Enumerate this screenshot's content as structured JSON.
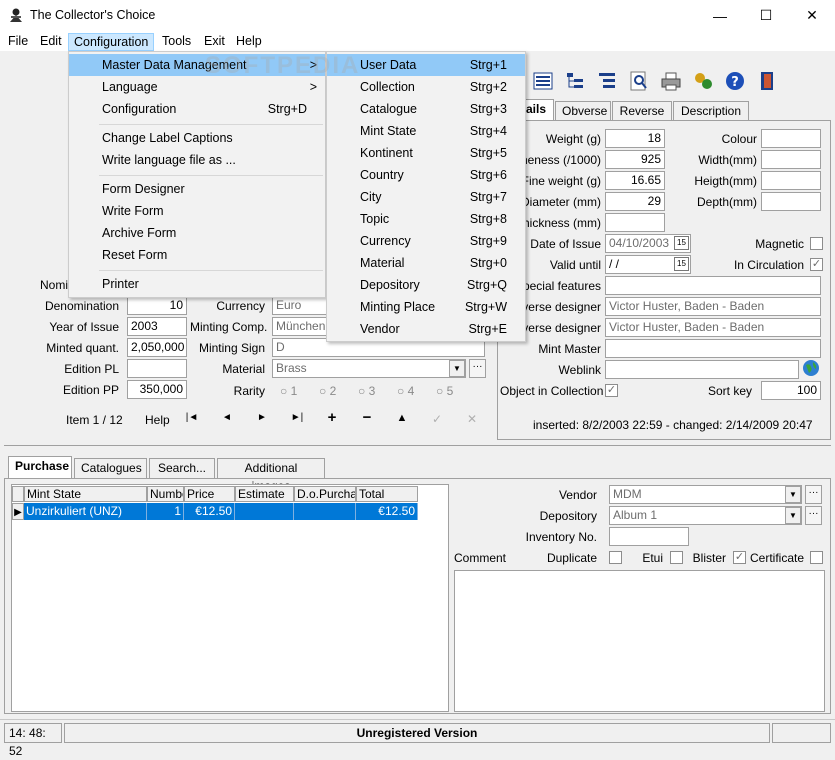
{
  "window": {
    "title": "The Collector's Choice",
    "minimize": "—",
    "maximize": "☐",
    "close": "✕"
  },
  "menubar": [
    "File",
    "Edit",
    "Configuration",
    "Tools",
    "Exit",
    "Help"
  ],
  "config_menu": {
    "items": [
      {
        "label": "Master Data Management",
        "arrow": ">"
      },
      {
        "label": "Language",
        "arrow": ">"
      },
      {
        "label": "Configuration",
        "shortcut": "Strg+D"
      },
      {
        "label": "Change Label Captions"
      },
      {
        "label": "Write language file as ..."
      },
      {
        "label": "Form Designer"
      },
      {
        "label": "Write Form"
      },
      {
        "label": "Archive Form"
      },
      {
        "label": "Reset Form"
      },
      {
        "label": "Printer"
      }
    ]
  },
  "master_submenu": {
    "items": [
      {
        "label": "User Data",
        "shortcut": "Strg+1"
      },
      {
        "label": "Collection",
        "shortcut": "Strg+2"
      },
      {
        "label": "Catalogue",
        "shortcut": "Strg+3"
      },
      {
        "label": "Mint State",
        "shortcut": "Strg+4"
      },
      {
        "label": "Kontinent",
        "shortcut": "Strg+5"
      },
      {
        "label": "Country",
        "shortcut": "Strg+6"
      },
      {
        "label": "City",
        "shortcut": "Strg+7"
      },
      {
        "label": "Topic",
        "shortcut": "Strg+8"
      },
      {
        "label": "Currency",
        "shortcut": "Strg+9"
      },
      {
        "label": "Material",
        "shortcut": "Strg+0"
      },
      {
        "label": "Depository",
        "shortcut": "Strg+Q"
      },
      {
        "label": "Minting Place",
        "shortcut": "Strg+W"
      },
      {
        "label": "Vendor",
        "shortcut": "Strg+E"
      }
    ]
  },
  "watermark": "SOFTPEDIA",
  "detail_tabs": [
    "ails",
    "Obverse",
    "Reverse",
    "Description"
  ],
  "details": {
    "weight_label": "Weight (g)",
    "weight": "18",
    "fineness_label": "neness (/1000)",
    "fineness": "925",
    "fine_weight_label": "Fine weight (g)",
    "fine_weight": "16.65",
    "diameter_label": "Diameter (mm)",
    "diameter": "29",
    "thickness_label": "Thickness (mm)",
    "thickness": "",
    "date_issue_label": "Date of Issue",
    "date_issue": "04/10/2003",
    "valid_until_label": "Valid until",
    "valid_until": " /  /",
    "calendar_icon_text": "15",
    "colour_label": "Colour",
    "width_label": "Width(mm)",
    "height_label": "Heigth(mm)",
    "depth_label": "Depth(mm)",
    "magnetic_label": "Magnetic",
    "in_circulation_label": "In Circulation",
    "special_features_label": "Special features",
    "obverse_designer_label": "verse designer",
    "obverse_designer": "Victor Huster, Baden - Baden",
    "reverse_designer_label": "everse designer",
    "reverse_designer": "Victor Huster, Baden - Baden",
    "mint_master_label": "Mint Master",
    "weblink_label": "Weblink",
    "object_in_collection_label": "Object in Collection",
    "sort_key_label": "Sort key",
    "sort_key": "100",
    "inserted_changed": "inserted: 8/2/2003 22:59 - changed: 2/14/2009 20:47"
  },
  "left_form": {
    "nomi_label": "Nomi",
    "denomination_label": "Denomination",
    "denomination": "10",
    "year_label": "Year of Issue",
    "year": "2003",
    "minted_label": "Minted quant.",
    "minted": "2,050,000",
    "edition_pl_label": "Edition PL",
    "edition_pl": "",
    "edition_pp_label": "Edition PP",
    "edition_pp": "350,000",
    "currency_label": "Currency",
    "currency": "Euro",
    "minting_comp_label": "Minting Comp.",
    "minting_comp": "München",
    "minting_sign_label": "Minting Sign",
    "minting_sign": "D",
    "material_label": "Material",
    "material": "Brass",
    "rarity_label": "Rarity",
    "rarity_options": [
      "1",
      "2",
      "3",
      "4",
      "5"
    ]
  },
  "nav": {
    "item_counter": "Item 1 / 12",
    "help": "Help",
    "first": "|◄",
    "prev": "◄",
    "next": "►",
    "last": "►|",
    "add": "+",
    "remove": "−",
    "up": "▲",
    "check": "✓",
    "cancel": "✕"
  },
  "bottom_tabs": [
    "Purchase",
    "Catalogues",
    "Search...",
    "Additional images"
  ],
  "grid": {
    "columns": [
      "Mint State",
      "Numbe",
      "Price",
      "Estimate",
      "D.o.Purchas",
      "Total"
    ],
    "rows": [
      {
        "marker": "▶",
        "mint_state": "Unzirkuliert (UNZ)",
        "number": "1",
        "price": "€12.50",
        "estimate": "",
        "purchase_date": "",
        "total": "€12.50"
      }
    ]
  },
  "purchase": {
    "vendor_label": "Vendor",
    "vendor": "MDM",
    "depository_label": "Depository",
    "depository": "Album 1",
    "inventory_label": "Inventory No.",
    "comment_label": "Comment",
    "duplicate_label": "Duplicate",
    "etui_label": "Etui",
    "blister_label": "Blister",
    "certificate_label": "Certificate"
  },
  "status": {
    "time": "14: 48: 52",
    "message": "Unregistered Version"
  },
  "colors": {
    "selection": "#0078d7",
    "menu_highlight": "#91c9f7",
    "menu_active": "#cce8ff"
  }
}
